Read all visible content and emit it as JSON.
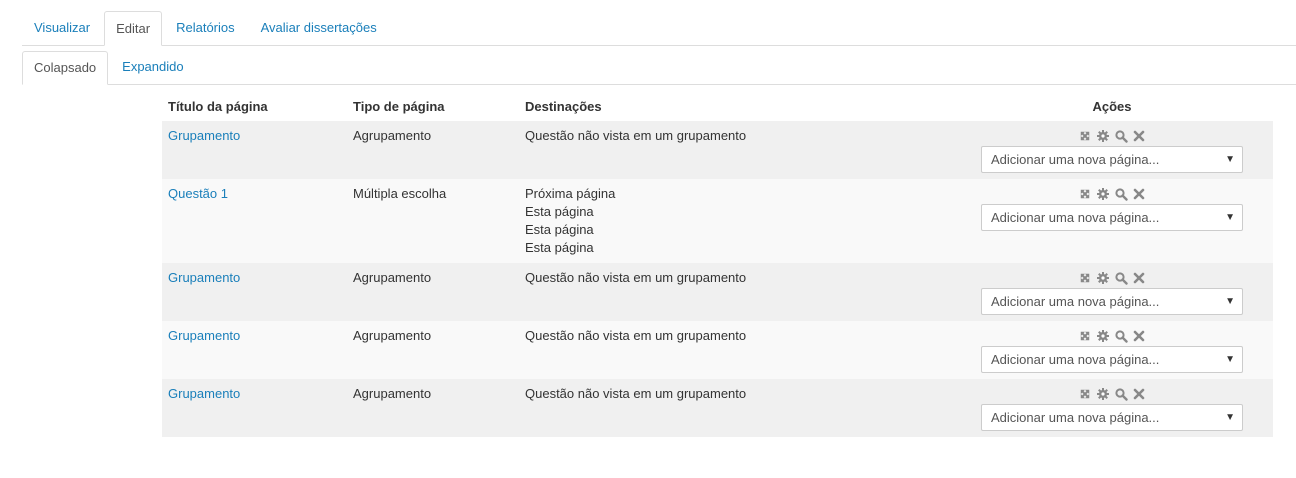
{
  "tabs_primary": [
    "Visualizar",
    "Editar",
    "Relatórios",
    "Avaliar dissertações"
  ],
  "tabs_secondary": [
    "Colapsado",
    "Expandido"
  ],
  "table": {
    "headers": {
      "title": "Título da página",
      "type": "Tipo de página",
      "destinations": "Destinações",
      "actions": "Ações"
    },
    "rows": [
      {
        "title": "Grupamento",
        "type": "Agrupamento",
        "destinations": [
          "Questão não vista em um grupamento"
        ],
        "select": "Adicionar uma nova página..."
      },
      {
        "title": "Questão 1",
        "type": "Múltipla escolha",
        "destinations": [
          "Próxima página",
          "Esta página",
          "Esta página",
          "Esta página"
        ],
        "select": "Adicionar uma nova página..."
      },
      {
        "title": "Grupamento",
        "type": "Agrupamento",
        "destinations": [
          "Questão não vista em um grupamento"
        ],
        "select": "Adicionar uma nova página..."
      },
      {
        "title": "Grupamento",
        "type": "Agrupamento",
        "destinations": [
          "Questão não vista em um grupamento"
        ],
        "select": "Adicionar uma nova página..."
      },
      {
        "title": "Grupamento",
        "type": "Agrupamento",
        "destinations": [
          "Questão não vista em um grupamento"
        ],
        "select": "Adicionar uma nova página..."
      }
    ]
  },
  "action_icons": [
    "move-icon",
    "gear-icon",
    "search-icon",
    "close-icon"
  ],
  "colors": {
    "link": "#1a7fba",
    "row_odd": "#f0f0f0",
    "row_even": "#f9f9f9",
    "icon": "#888888"
  }
}
